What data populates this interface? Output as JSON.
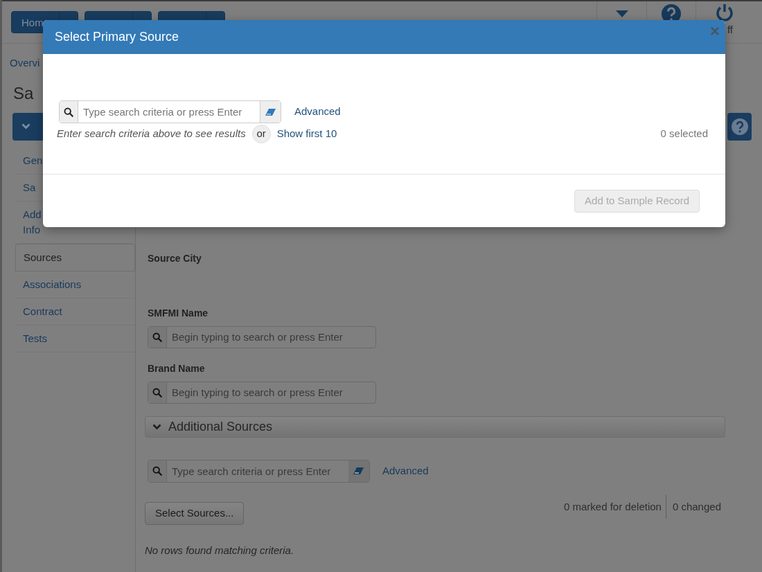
{
  "header": {
    "nav_buttons": [
      {
        "kind": "split",
        "label": "Hom"
      },
      {
        "kind": "split"
      },
      {
        "kind": "split"
      }
    ],
    "log_off_label": "ff"
  },
  "breadcrumb": "Overvi",
  "page_title": "Sa",
  "section_bar": {
    "expanded": true
  },
  "sidebar": {
    "items": [
      {
        "label": "Gen",
        "selected": false
      },
      {
        "label": "Sa",
        "selected": false
      },
      {
        "label": "Add\nInfo",
        "selected": false
      },
      {
        "label": "Sources",
        "selected": true
      },
      {
        "label": "Associations",
        "selected": false
      },
      {
        "label": "Contract",
        "selected": false
      },
      {
        "label": "Tests",
        "selected": false
      }
    ]
  },
  "source_city": {
    "label": "Source City"
  },
  "smfmi_name": {
    "label": "SMFMI Name",
    "placeholder": "Begin typing to search or press Enter"
  },
  "brand_name": {
    "label": "Brand Name",
    "placeholder": "Begin typing to search or press Enter"
  },
  "additional_sources": {
    "title": "Additional Sources",
    "expanded": true,
    "search_placeholder": "Type search criteria or press Enter",
    "advanced_link": "Advanced",
    "select_button": "Select Sources...",
    "marked_for_deletion": "0 marked for deletion",
    "changed": "0 changed",
    "empty_message": "No rows found matching criteria."
  },
  "modal": {
    "title": "Select Primary Source",
    "close": "×",
    "search_placeholder": "Type search criteria or press Enter",
    "advanced_link": "Advanced",
    "hint": "Enter search criteria above to see results",
    "or": "or",
    "show_first_link": "Show first 10",
    "selected_count": "0 selected",
    "add_button": {
      "label": "Add to Sample Record",
      "disabled": true
    }
  }
}
